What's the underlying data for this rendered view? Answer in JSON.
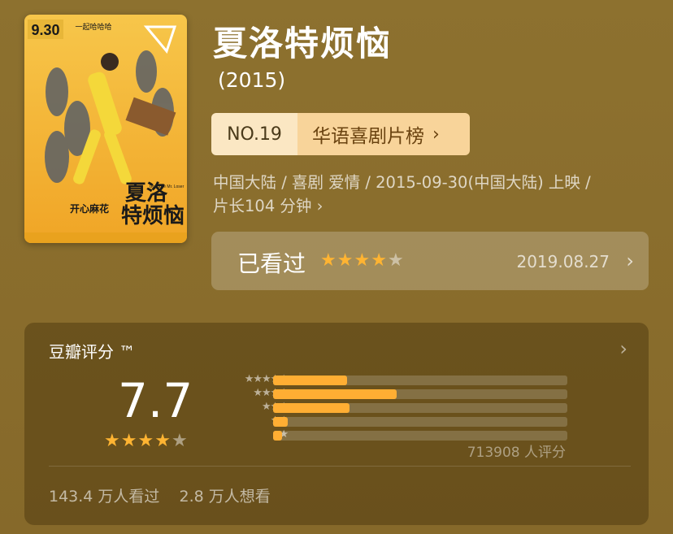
{
  "movie": {
    "title": "夏洛特烦恼",
    "year": "(2015)",
    "poster": {
      "date_text": "9.30",
      "tagline": "一起哈哈哈",
      "title_line1": "夏洛",
      "title_line2": "特烦恼",
      "subtitle": "开心麻花",
      "english": "Goodbye Mr. Loser"
    },
    "rank": {
      "number": "NO.19",
      "list_name": "华语喜剧片榜",
      "chevron": "chevron-right-icon"
    },
    "meta_line1": "中国大陆 / 喜剧 爱情 / 2015-09-30(中国大陆) 上映 /",
    "meta_line2": "片长104 分钟"
  },
  "watched": {
    "label": "已看过",
    "user_stars": 4,
    "max_stars": 5,
    "date": "2019.08.27",
    "chevron": "chevron-right-icon"
  },
  "rating": {
    "header": "豆瓣评分 ™",
    "score": "7.7",
    "score_stars": 4,
    "distribution": [
      {
        "stars": 5,
        "fraction": 0.25
      },
      {
        "stars": 4,
        "fraction": 0.42
      },
      {
        "stars": 3,
        "fraction": 0.26
      },
      {
        "stars": 2,
        "fraction": 0.05
      },
      {
        "stars": 1,
        "fraction": 0.03
      }
    ],
    "count": "713908 人评分",
    "watched_count": "143.4 万人看过",
    "want_count": "2.8 万人想看"
  },
  "colors": {
    "background": "#8a6f2e",
    "accent_star": "#ffb432",
    "bar_fill": "#ffae33",
    "rank_number_bg": "#fbe7c3",
    "rank_name_bg": "#f8d49a"
  }
}
